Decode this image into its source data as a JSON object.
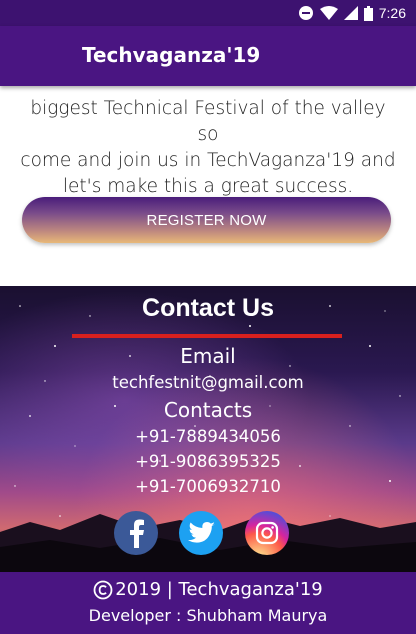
{
  "status_bar": {
    "time": "7:26"
  },
  "app_bar": {
    "title": "Techvaganza'19"
  },
  "about": {
    "lines": [
      "biggest Technical Festival of the valley so",
      "come and join us in TechVaganza'19 and",
      "let's make this a great success."
    ]
  },
  "register": {
    "label": "REGISTER NOW"
  },
  "contact": {
    "title": "Contact Us",
    "email_heading": "Email",
    "email": "techfestnit@gmail.com",
    "contacts_heading": "Contacts",
    "phones": [
      "+91-7889434056",
      "+91-9086395325",
      "+91-7006932710"
    ]
  },
  "social": {
    "icons": [
      "facebook-icon",
      "twitter-icon",
      "instagram-icon"
    ],
    "colors": {
      "facebook": "#3b5998",
      "twitter": "#1da1f2",
      "instagram": "#c13584"
    }
  },
  "footer": {
    "copyright": "2019 | Techvaganza'19",
    "developer": "Developer : Shubham Maurya"
  },
  "colors": {
    "brand": "#4a1582",
    "accent_line": "#d8201e"
  }
}
